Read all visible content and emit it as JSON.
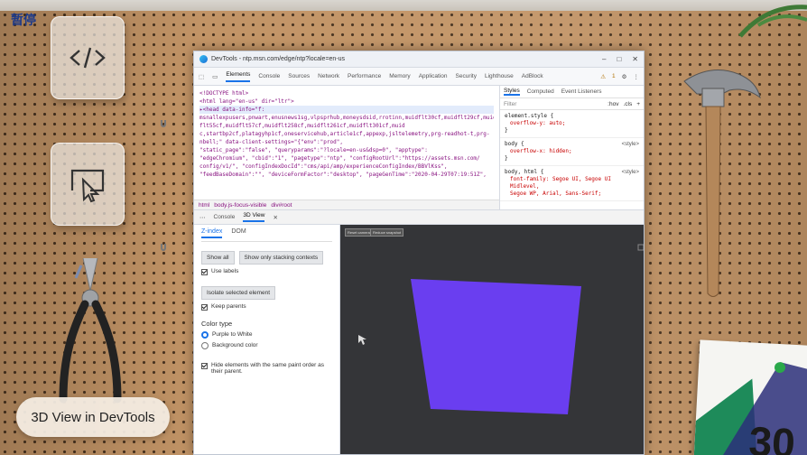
{
  "overlay": {
    "status_label": "暂停"
  },
  "caption": {
    "text": "3D View in DevTools"
  },
  "window": {
    "title": "DevTools - ntp.msn.com/edge/ntp?locale=en-us",
    "controls": [
      "–",
      "□",
      "✕"
    ]
  },
  "main_tabs": [
    "Elements",
    "Console",
    "Sources",
    "Network",
    "Performance",
    "Memory",
    "Application",
    "Security",
    "Lighthouse",
    "AdBlock"
  ],
  "toolbar": {
    "warning_count": "1"
  },
  "elements": {
    "code_lines": [
      "<!DOCTYPE html>",
      "<html lang=\"en-us\" dir=\"ltr\">",
      " ▸<head data-info=\"f:",
      "msnallexpusers,pnwart,enusnews1sg,vlpsprhub,moneysdsid,rrotinn,muidflt30cf,muidflt29cf,muid",
      "flt55cf,muidflt57cf,muidflt258cf,muidflt261cf,muidflt301cf,muid",
      "c,startbp2cf,platagyhp1cf,oneservicehub,article1cf,appexp,jsltelemetry,prg-readhot-t,prg-",
      "nbell;\" data-client-settings=\"{\"env\":\"prod\",",
      "\"static_page\":\"false\", \"queryparams\":\"?locale=en-us&dsp=0\", \"apptype\":",
      "\"edgeChromium\", \"cbid\":\"1\", \"pagetype\":\"ntp\", \"configRootUrl\":\"https://assets.msn.com/",
      "config/v1/\", \"configIndexDocId\":\"cms/api/amp/experienceConfigIndex/BBVlKss\",",
      "\"feedBaseDomain\":\"\", \"deviceFormFactor\":\"desktop\", \"pageGenTime\":\"2020-04-29T07:19:51Z\","
    ],
    "breadcrumbs": [
      "html",
      "body.js-focus-visible",
      "div#root"
    ]
  },
  "styles": {
    "tabs": [
      "Styles",
      "Computed",
      "Event Listeners"
    ],
    "filter_placeholder": "Filter",
    "filter_buttons": [
      ":hov",
      ".cls",
      "+"
    ],
    "rules": [
      {
        "selector": "element.style {",
        "props": [
          "overflow-y: auto;"
        ],
        "source": ""
      },
      {
        "selector": "body {",
        "props": [
          "overflow-x: hidden;"
        ],
        "source": "<style>"
      },
      {
        "selector": "body, html {",
        "props": [
          "font-family: Segoe UI, Segoe UI Midlevel,",
          "Segoe WP, Arial, Sans-Serif;"
        ],
        "source": "<style>"
      }
    ]
  },
  "drawer": {
    "tabs": [
      "Console",
      "3D View"
    ],
    "close_label": "✕"
  },
  "panel3d": {
    "subtabs": [
      "Z-index",
      "DOM"
    ],
    "show_all_label": "Show all",
    "show_stacking_label": "Show only stacking contexts",
    "use_labels_label": "Use labels",
    "isolate_label": "Isolate selected element",
    "keep_parents_label": "Keep parents",
    "color_type_label": "Color type",
    "purple_to_white_label": "Purple to White",
    "background_color_label": "Background color",
    "hide_elements_label": "Hide elements with the same paint order as their parent."
  },
  "viewport": {
    "chips": [
      "Reset camera",
      "Reduce snapshot"
    ],
    "layer_color": "#6a3ef0"
  },
  "colors": {
    "accent": "#1a73e8",
    "viewport_bg": "#343538"
  }
}
